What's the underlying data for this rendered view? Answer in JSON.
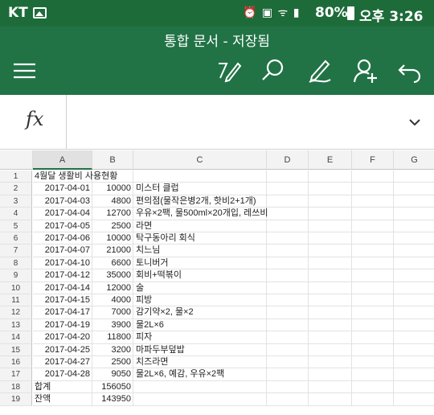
{
  "status_bar": {
    "carrier": "KT",
    "battery": "80%",
    "time": "오후 3:26"
  },
  "document": {
    "title": "통합 문서 - 저장됨"
  },
  "formula_bar": {
    "fx_label": "fx",
    "value": ""
  },
  "columns": [
    "A",
    "B",
    "C",
    "D",
    "E",
    "F",
    "G"
  ],
  "active_column": "A",
  "rows": [
    {
      "n": "1",
      "a": "4월달 생활비 사용현황",
      "b": "",
      "c": "",
      "a_align": "left"
    },
    {
      "n": "2",
      "a": "2017-04-01",
      "b": "10000",
      "c": "미스터 클럽"
    },
    {
      "n": "3",
      "a": "2017-04-03",
      "b": "4800",
      "c": "편의점(물작은병2개, 핫비2+1개)"
    },
    {
      "n": "4",
      "a": "2017-04-04",
      "b": "12700",
      "c": "우유×2팩, 물500ml×20개입, 레쓰비"
    },
    {
      "n": "5",
      "a": "2017-04-05",
      "b": "2500",
      "c": "라면"
    },
    {
      "n": "6",
      "a": "2017-04-06",
      "b": "10000",
      "c": "탁구동아리 회식"
    },
    {
      "n": "7",
      "a": "2017-04-07",
      "b": "21000",
      "c": "치느님"
    },
    {
      "n": "8",
      "a": "2017-04-10",
      "b": "6600",
      "c": "토니버거"
    },
    {
      "n": "9",
      "a": "2017-04-12",
      "b": "35000",
      "c": "회비+떡볶이"
    },
    {
      "n": "10",
      "a": "2017-04-14",
      "b": "12000",
      "c": "술"
    },
    {
      "n": "11",
      "a": "2017-04-15",
      "b": "4000",
      "c": "피방"
    },
    {
      "n": "12",
      "a": "2017-04-17",
      "b": "7000",
      "c": "감기약×2, 물×2"
    },
    {
      "n": "13",
      "a": "2017-04-19",
      "b": "3900",
      "c": "물2L×6"
    },
    {
      "n": "14",
      "a": "2017-04-20",
      "b": "11800",
      "c": "피자"
    },
    {
      "n": "15",
      "a": "2017-04-25",
      "b": "3200",
      "c": "마파두부덮밥"
    },
    {
      "n": "16",
      "a": "2017-04-27",
      "b": "2500",
      "c": "치즈라면"
    },
    {
      "n": "17",
      "a": "2017-04-28",
      "b": "9050",
      "c": "물2L×6, 예감, 우유×2팩"
    },
    {
      "n": "18",
      "a": "합계",
      "b": "156050",
      "c": "",
      "a_align": "left"
    },
    {
      "n": "19",
      "a": "잔액",
      "b": "143950",
      "c": "",
      "a_align": "left"
    }
  ],
  "colors": {
    "header_green": "#217346",
    "status_green": "#1e6b3a"
  },
  "icons": {
    "toolbar": [
      "menu-icon",
      "format-pen-icon",
      "search-icon",
      "draw-icon",
      "share-person-icon",
      "undo-icon"
    ]
  }
}
